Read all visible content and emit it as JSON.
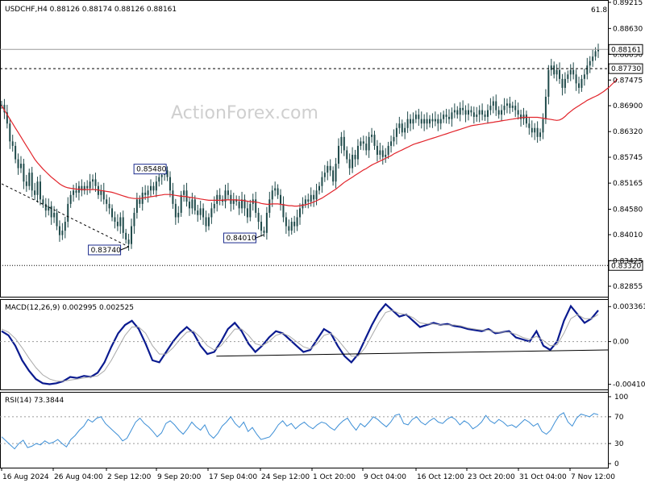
{
  "chart_data": [
    {
      "type": "candlestick",
      "panel": "main",
      "header": "USDCHF,H4  0.88126 0.88174 0.88126 0.88161",
      "watermark": "ActionForex.com",
      "fib_label": "61.8",
      "ylim": [
        0.8262,
        0.8925
      ],
      "y_ticks": [
        "0.89215",
        "0.88630",
        "0.88050",
        "0.87475",
        "0.86900",
        "0.86320",
        "0.85745",
        "0.85165",
        "0.84580",
        "0.84010",
        "0.83425",
        "0.82855"
      ],
      "y_tick_values": [
        0.89215,
        0.8863,
        0.8805,
        0.87475,
        0.869,
        0.8632,
        0.85745,
        0.85165,
        0.8458,
        0.8401,
        0.83425,
        0.82855
      ],
      "current_price_label": "0.88161",
      "current_price": 0.88161,
      "levels": [
        {
          "label": "0.87730",
          "value": 0.8773,
          "style": "dashed"
        },
        {
          "label": "0.83320",
          "value": 0.8332,
          "style": "dotted"
        }
      ],
      "annotations": [
        {
          "label": "0.85480",
          "value": 0.8548,
          "bar": 59
        },
        {
          "label": "0.83740",
          "value": 0.8374,
          "bar": 46
        },
        {
          "label": "0.84010",
          "value": 0.8401,
          "bar": 95
        }
      ],
      "close_series": [
        0.8692,
        0.8675,
        0.865,
        0.861,
        0.86,
        0.857,
        0.855,
        0.856,
        0.852,
        0.851,
        0.854,
        0.85,
        0.849,
        0.852,
        0.848,
        0.847,
        0.8455,
        0.8465,
        0.844,
        0.845,
        0.842,
        0.84,
        0.841,
        0.843,
        0.847,
        0.849,
        0.85,
        0.8495,
        0.851,
        0.85,
        0.851,
        0.8505,
        0.852,
        0.8525,
        0.851,
        0.849,
        0.85,
        0.848,
        0.847,
        0.846,
        0.844,
        0.843,
        0.842,
        0.844,
        0.8405,
        0.839,
        0.838,
        0.842,
        0.845,
        0.848,
        0.847,
        0.8495,
        0.849,
        0.85,
        0.851,
        0.85,
        0.852,
        0.853,
        0.8535,
        0.8545,
        0.853,
        0.85,
        0.847,
        0.844,
        0.845,
        0.849,
        0.85,
        0.8475,
        0.846,
        0.848,
        0.8455,
        0.8445,
        0.846,
        0.844,
        0.842,
        0.844,
        0.846,
        0.847,
        0.849,
        0.848,
        0.8475,
        0.85,
        0.849,
        0.847,
        0.848,
        0.8475,
        0.846,
        0.848,
        0.846,
        0.844,
        0.847,
        0.848,
        0.845,
        0.843,
        0.841,
        0.8405,
        0.845,
        0.848,
        0.85,
        0.8505,
        0.849,
        0.847,
        0.844,
        0.842,
        0.841,
        0.843,
        0.842,
        0.844,
        0.846,
        0.847,
        0.848,
        0.8475,
        0.849,
        0.848,
        0.85,
        0.851,
        0.853,
        0.854,
        0.8555,
        0.8545,
        0.852,
        0.856,
        0.86,
        0.862,
        0.859,
        0.857,
        0.855,
        0.858,
        0.857,
        0.86,
        0.861,
        0.8605,
        0.859,
        0.862,
        0.8625,
        0.86,
        0.858,
        0.859,
        0.8575,
        0.858,
        0.86,
        0.861,
        0.862,
        0.864,
        0.865,
        0.863,
        0.864,
        0.866,
        0.865,
        0.866,
        0.867,
        0.866,
        0.865,
        0.866,
        0.865,
        0.866,
        0.8655,
        0.866,
        0.865,
        0.866,
        0.867,
        0.8665,
        0.866,
        0.8675,
        0.868,
        0.867,
        0.8685,
        0.868,
        0.867,
        0.868,
        0.8675,
        0.8665,
        0.867,
        0.868,
        0.867,
        0.8665,
        0.868,
        0.869,
        0.87,
        0.868,
        0.867,
        0.868,
        0.869,
        0.8695,
        0.8685,
        0.869,
        0.868,
        0.867,
        0.866,
        0.867,
        0.865,
        0.864,
        0.863,
        0.864,
        0.862,
        0.863,
        0.866,
        0.871,
        0.877,
        0.878,
        0.876,
        0.877,
        0.875,
        0.873,
        0.875,
        0.876,
        0.877,
        0.876,
        0.874,
        0.873,
        0.875,
        0.876,
        0.878,
        0.879,
        0.88,
        0.8812,
        0.8816
      ],
      "ma_series": [
        0.869,
        0.868,
        0.867,
        0.866,
        0.865,
        0.864,
        0.863,
        0.862,
        0.861,
        0.86,
        0.859,
        0.858,
        0.857,
        0.8562,
        0.8555,
        0.8548,
        0.8542,
        0.8536,
        0.853,
        0.8525,
        0.852,
        0.8515,
        0.8511,
        0.8508,
        0.8506,
        0.8505,
        0.8504,
        0.8503,
        0.8503,
        0.8502,
        0.8502,
        0.8502,
        0.8502,
        0.8502,
        0.8502,
        0.8501,
        0.85,
        0.8499,
        0.8498,
        0.8497,
        0.8496,
        0.8494,
        0.8492,
        0.849,
        0.8488,
        0.8486,
        0.8484,
        0.8483,
        0.8482,
        0.8482,
        0.8482,
        0.8483,
        0.8484,
        0.8485,
        0.8486,
        0.8487,
        0.8488,
        0.8489,
        0.849,
        0.8491,
        0.8491,
        0.8491,
        0.849,
        0.8489,
        0.8488,
        0.8487,
        0.8487,
        0.8486,
        0.8485,
        0.8484,
        0.8483,
        0.8482,
        0.8481,
        0.848,
        0.8479,
        0.8478,
        0.8478,
        0.8478,
        0.8478,
        0.8478,
        0.8478,
        0.8479,
        0.8479,
        0.8479,
        0.8479,
        0.8479,
        0.8478,
        0.8478,
        0.8477,
        0.8476,
        0.8475,
        0.8475,
        0.8474,
        0.8473,
        0.8471,
        0.847,
        0.8469,
        0.8469,
        0.847,
        0.847,
        0.847,
        0.8469,
        0.8468,
        0.8467,
        0.8466,
        0.8466,
        0.8465,
        0.8465,
        0.8466,
        0.8467,
        0.8468,
        0.847,
        0.8472,
        0.8474,
        0.8477,
        0.848,
        0.8483,
        0.8487,
        0.8491,
        0.8495,
        0.8499,
        0.8503,
        0.8508,
        0.8513,
        0.8518,
        0.8522,
        0.8526,
        0.853,
        0.8534,
        0.8538,
        0.8542,
        0.8546,
        0.8549,
        0.8553,
        0.8557,
        0.856,
        0.8563,
        0.8566,
        0.8569,
        0.8572,
        0.8575,
        0.8578,
        0.8582,
        0.8585,
        0.8588,
        0.8591,
        0.8594,
        0.8597,
        0.86,
        0.8603,
        0.8605,
        0.8607,
        0.8609,
        0.8611,
        0.8613,
        0.8615,
        0.8617,
        0.8619,
        0.8621,
        0.8623,
        0.8625,
        0.8627,
        0.8629,
        0.8631,
        0.8633,
        0.8635,
        0.8637,
        0.8639,
        0.8641,
        0.8643,
        0.8645,
        0.8646,
        0.8647,
        0.8648,
        0.8649,
        0.865,
        0.8651,
        0.8652,
        0.8653,
        0.8654,
        0.8655,
        0.8656,
        0.8657,
        0.8658,
        0.8659,
        0.866,
        0.8661,
        0.8662,
        0.8663,
        0.8664,
        0.8664,
        0.8664,
        0.8664,
        0.8664,
        0.8664,
        0.8663,
        0.8662,
        0.8661,
        0.866,
        0.8659,
        0.8658,
        0.8657,
        0.8658,
        0.8661,
        0.8666,
        0.8672,
        0.8677,
        0.8682,
        0.8686,
        0.869,
        0.8694,
        0.8698,
        0.8702,
        0.8705,
        0.8708,
        0.8711,
        0.8714,
        0.8718,
        0.8722,
        0.8727,
        0.8732,
        0.8738,
        0.8744,
        0.875
      ]
    },
    {
      "type": "line",
      "panel": "macd",
      "header": "MACD(12,26,9) 0.002995 0.002525",
      "ylim": [
        -0.0046,
        0.004
      ],
      "y_ticks": [
        "0.003361",
        "0.00",
        "-0.004108"
      ],
      "y_tick_values": [
        0.003361,
        0.0,
        -0.004108
      ],
      "series": [
        {
          "role": "main",
          "values": [
            0.001,
            0.0006,
            -0.0004,
            -0.0018,
            -0.0028,
            -0.0036,
            -0.004,
            -0.0041,
            -0.004,
            -0.0038,
            -0.0034,
            -0.0035,
            -0.0033,
            -0.0034,
            -0.003,
            -0.002,
            -0.0005,
            0.0008,
            0.0016,
            0.002,
            0.0012,
            -0.0002,
            -0.0018,
            -0.002,
            -0.001,
            0.0,
            0.0008,
            0.0014,
            0.0008,
            -0.0004,
            -0.0012,
            -0.001,
            0.0,
            0.0012,
            0.0018,
            0.001,
            -0.0002,
            -0.001,
            -0.0004,
            0.0004,
            0.001,
            0.0008,
            0.0002,
            -0.0004,
            -0.001,
            -0.0008,
            0.0002,
            0.0012,
            0.0008,
            -0.0004,
            -0.0014,
            -0.002,
            -0.0012,
            0.0002,
            0.0016,
            0.0028,
            0.0036,
            0.003,
            0.0024,
            0.0026,
            0.002,
            0.0014,
            0.0016,
            0.0018,
            0.0016,
            0.0017,
            0.0015,
            0.0014,
            0.0012,
            0.0011,
            0.001,
            0.0012,
            0.0008,
            0.0009,
            0.001,
            0.0004,
            0.0002,
            0.0,
            0.001,
            -0.0004,
            -0.0008,
            0.0,
            0.002,
            0.0034,
            0.0026,
            0.0018,
            0.0022,
            0.003
          ]
        },
        {
          "role": "signal",
          "values": [
            0.0012,
            0.0009,
            0.0003,
            -0.0006,
            -0.0016,
            -0.0025,
            -0.0032,
            -0.0036,
            -0.0038,
            -0.0038,
            -0.0037,
            -0.0036,
            -0.0035,
            -0.0034,
            -0.0033,
            -0.0028,
            -0.0018,
            -0.0006,
            0.0006,
            0.0014,
            0.0014,
            0.0008,
            -0.0004,
            -0.0012,
            -0.0012,
            -0.0006,
            0.0002,
            0.0009,
            0.001,
            0.0004,
            -0.0004,
            -0.0008,
            -0.0004,
            0.0004,
            0.0012,
            0.0012,
            0.0006,
            -0.0002,
            -0.0004,
            0.0,
            0.0006,
            0.0008,
            0.0005,
            0.0,
            -0.0005,
            -0.0007,
            -0.0002,
            0.0006,
            0.0008,
            0.0002,
            -0.0006,
            -0.0014,
            -0.0014,
            -0.0006,
            0.0006,
            0.0018,
            0.0028,
            0.003,
            0.0027,
            0.0026,
            0.0023,
            0.0018,
            0.0017,
            0.0017,
            0.0016,
            0.0016,
            0.0016,
            0.0015,
            0.0013,
            0.0012,
            0.0011,
            0.0011,
            0.0009,
            0.0009,
            0.0009,
            0.0007,
            0.0004,
            0.0002,
            0.0005,
            0.0001,
            -0.0004,
            -0.0003,
            0.0008,
            0.0022,
            0.0026,
            0.0022,
            0.0022,
            0.0026
          ]
        }
      ],
      "trendline": [
        [
          0.36,
          -0.0014
        ],
        [
          1.0,
          -0.0008
        ]
      ]
    },
    {
      "type": "line",
      "panel": "rsi",
      "header": "RSI(14) 73.3844",
      "ylim": [
        0,
        100
      ],
      "y_ticks": [
        "100",
        "70",
        "30",
        "0"
      ],
      "y_tick_values": [
        100,
        70,
        30,
        0
      ],
      "levels": [
        70,
        30
      ],
      "values": [
        40,
        34,
        28,
        22,
        30,
        35,
        24,
        26,
        30,
        28,
        34,
        30,
        32,
        36,
        30,
        25,
        36,
        42,
        50,
        56,
        66,
        62,
        68,
        70,
        60,
        54,
        48,
        42,
        34,
        38,
        50,
        62,
        68,
        60,
        55,
        48,
        40,
        46,
        60,
        64,
        58,
        50,
        44,
        52,
        62,
        55,
        50,
        58,
        44,
        38,
        45,
        56,
        62,
        70,
        60,
        54,
        62,
        48,
        54,
        44,
        36,
        38,
        40,
        48,
        58,
        64,
        56,
        60,
        52,
        58,
        62,
        56,
        52,
        58,
        62,
        60,
        54,
        50,
        58,
        64,
        68,
        58,
        50,
        60,
        55,
        62,
        70,
        66,
        60,
        55,
        62,
        72,
        74,
        60,
        58,
        66,
        70,
        62,
        58,
        64,
        68,
        62,
        60,
        66,
        70,
        66,
        58,
        64,
        60,
        52,
        56,
        62,
        72,
        64,
        60,
        66,
        62,
        56,
        58,
        54,
        60,
        66,
        62,
        56,
        60,
        48,
        44,
        50,
        62,
        72,
        76,
        62,
        56,
        68,
        74,
        72,
        70,
        75,
        73
      ]
    }
  ],
  "x_labels": [
    "16 Aug 2024",
    "26 Aug 04:00",
    "2 Sep 12:00",
    "9 Sep 20:00",
    "17 Sep 04:00",
    "24 Sep 12:00",
    "1 Oct 20:00",
    "9 Oct 04:00",
    "16 Oct 12:00",
    "23 Oct 20:00",
    "31 Oct 04:00",
    "7 Nov 12:00"
  ],
  "colors": {
    "candle": "#1f4a4a",
    "ma": "#e2242b",
    "macd_main": "#0a1a8f",
    "macd_signal": "#a9a9a9",
    "rsi": "#3d8fd6",
    "grid": "#9a9a9a",
    "frame": "#000000"
  }
}
